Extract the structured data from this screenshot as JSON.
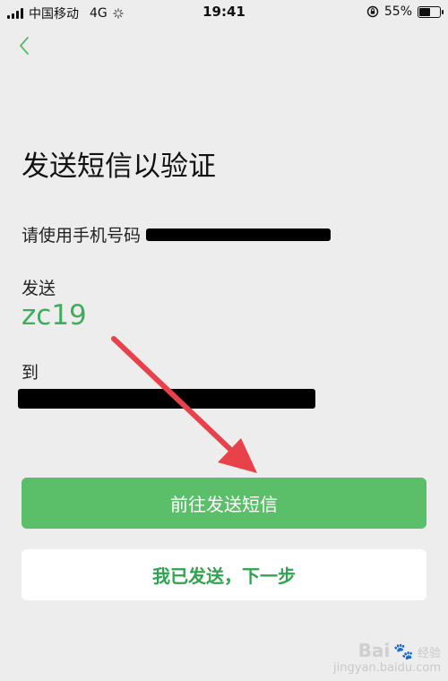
{
  "status_bar": {
    "carrier": "中国移动",
    "network": "4G",
    "time": "19:41",
    "battery_percent": "55%",
    "battery_level": 0.55
  },
  "page": {
    "title": "发送短信以验证",
    "instruction": "请使用手机号码",
    "send_label": "发送",
    "code": "zc19",
    "to_label": "到"
  },
  "buttons": {
    "primary": "前往发送短信",
    "secondary": "我已发送，下一步"
  },
  "watermark": {
    "brand": "Bai",
    "text": "经验",
    "sub": "jingyan.baidu.com"
  },
  "colors": {
    "accent": "#5bbf69",
    "code_text": "#3fae5b",
    "annotation_arrow": "#e8414a"
  },
  "icons": {
    "back": "chevron-left-icon",
    "loading": "loading-spinner-icon",
    "orientation_lock": "orientation-lock-icon"
  }
}
